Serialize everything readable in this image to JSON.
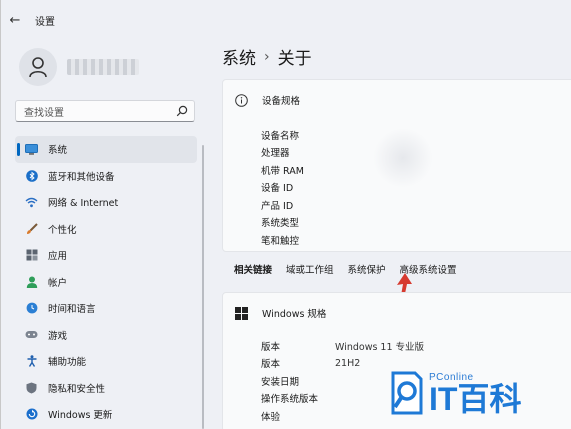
{
  "window": {
    "title": "设置"
  },
  "sidebar": {
    "search_placeholder": "查找设置",
    "items": [
      {
        "label": "系统",
        "icon": "monitor-icon",
        "active": true
      },
      {
        "label": "蓝牙和其他设备",
        "icon": "bluetooth-icon"
      },
      {
        "label": "网络 & Internet",
        "icon": "wifi-icon"
      },
      {
        "label": "个性化",
        "icon": "brush-icon"
      },
      {
        "label": "应用",
        "icon": "apps-icon"
      },
      {
        "label": "帐户",
        "icon": "user-icon"
      },
      {
        "label": "时间和语言",
        "icon": "globe-clock-icon"
      },
      {
        "label": "游戏",
        "icon": "gamepad-icon"
      },
      {
        "label": "辅助功能",
        "icon": "accessibility-icon"
      },
      {
        "label": "隐私和安全性",
        "icon": "shield-icon"
      },
      {
        "label": "Windows 更新",
        "icon": "update-icon"
      }
    ]
  },
  "main": {
    "breadcrumb_parent": "系统",
    "breadcrumb_sep": "›",
    "breadcrumb_current": "关于",
    "device_spec": {
      "title": "设备规格",
      "rows": [
        "设备名称",
        "处理器",
        "机带 RAM",
        "设备 ID",
        "产品 ID",
        "系统类型",
        "笔和触控"
      ]
    },
    "related": {
      "label": "相关链接",
      "links": [
        "域或工作组",
        "系统保护",
        "高级系统设置"
      ]
    },
    "windows_spec": {
      "title": "Windows 规格",
      "rows": [
        {
          "k": "版本",
          "v": "Windows 11 专业版"
        },
        {
          "k": "版本",
          "v": "21H2"
        },
        {
          "k": "安装日期",
          "v": ""
        },
        {
          "k": "操作系统版本",
          "v": ""
        },
        {
          "k": "体验",
          "v": ""
        }
      ]
    }
  },
  "watermark": {
    "small": "PConline",
    "big": "IT百科"
  },
  "colors": {
    "accent": "#0067c0",
    "arrow": "#d63a2f",
    "watermark": "#1e79d6"
  }
}
